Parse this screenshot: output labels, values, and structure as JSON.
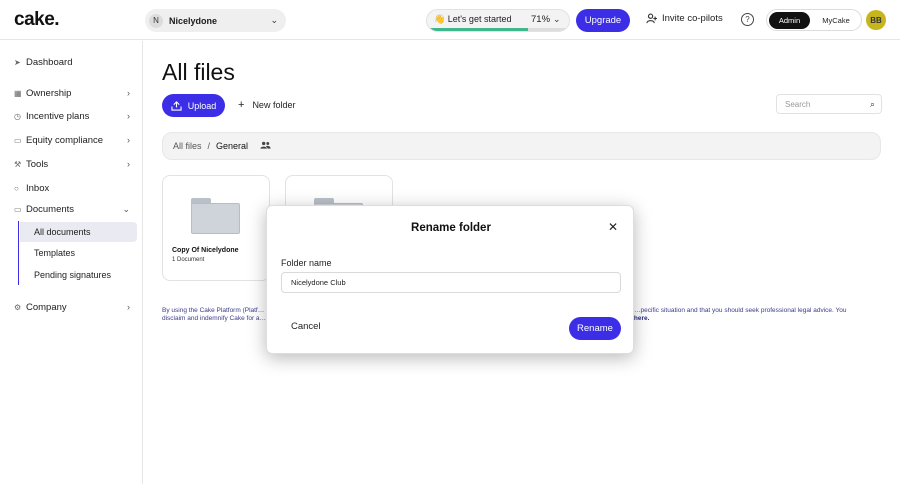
{
  "header": {
    "logo": "cake.",
    "company": {
      "initial": "N",
      "name": "Nicelydone"
    },
    "progress": {
      "label": "👋 Let's get started",
      "percent_text": "71%",
      "percent": 71
    },
    "upgrade_label": "Upgrade",
    "invite_label": "Invite co-pilots",
    "help_symbol": "?",
    "toggle": {
      "admin": "Admin",
      "mycake": "MyCake"
    },
    "user_initials": "BB"
  },
  "sidebar": {
    "items": [
      {
        "label": "Dashboard"
      },
      {
        "label": "Ownership"
      },
      {
        "label": "Incentive plans"
      },
      {
        "label": "Equity compliance"
      },
      {
        "label": "Tools"
      },
      {
        "label": "Inbox"
      },
      {
        "label": "Documents"
      },
      {
        "label": "Company"
      }
    ],
    "documents_sub": [
      {
        "label": "All documents",
        "active": true
      },
      {
        "label": "Templates"
      },
      {
        "label": "Pending signatures"
      }
    ]
  },
  "main": {
    "title": "All files",
    "upload_label": "Upload",
    "new_folder_label": "New folder",
    "search_placeholder": "Search",
    "breadcrumb": {
      "root": "All files",
      "separator": "/",
      "current": "General"
    },
    "folders": [
      {
        "name": "Copy Of Nicelydone",
        "count": "1 Document"
      },
      {
        "name": "",
        "count": ""
      }
    ],
    "disclaimer_left": "By using the Cake Platform (Platf…",
    "disclaimer_left2": "disclaim and indemnify Cake for a…",
    "disclaimer_right": "…pecific situation and that you should seek professional legal advice. You",
    "disclaimer_right2": "…y here."
  },
  "modal": {
    "title": "Rename folder",
    "field_label": "Folder name",
    "field_value": "Nicelydone Club",
    "cancel_label": "Cancel",
    "rename_label": "Rename"
  },
  "colors": {
    "accent": "#3b2ee6",
    "progress_fill": "#3fb68b",
    "avatar": "#c6b51b"
  }
}
